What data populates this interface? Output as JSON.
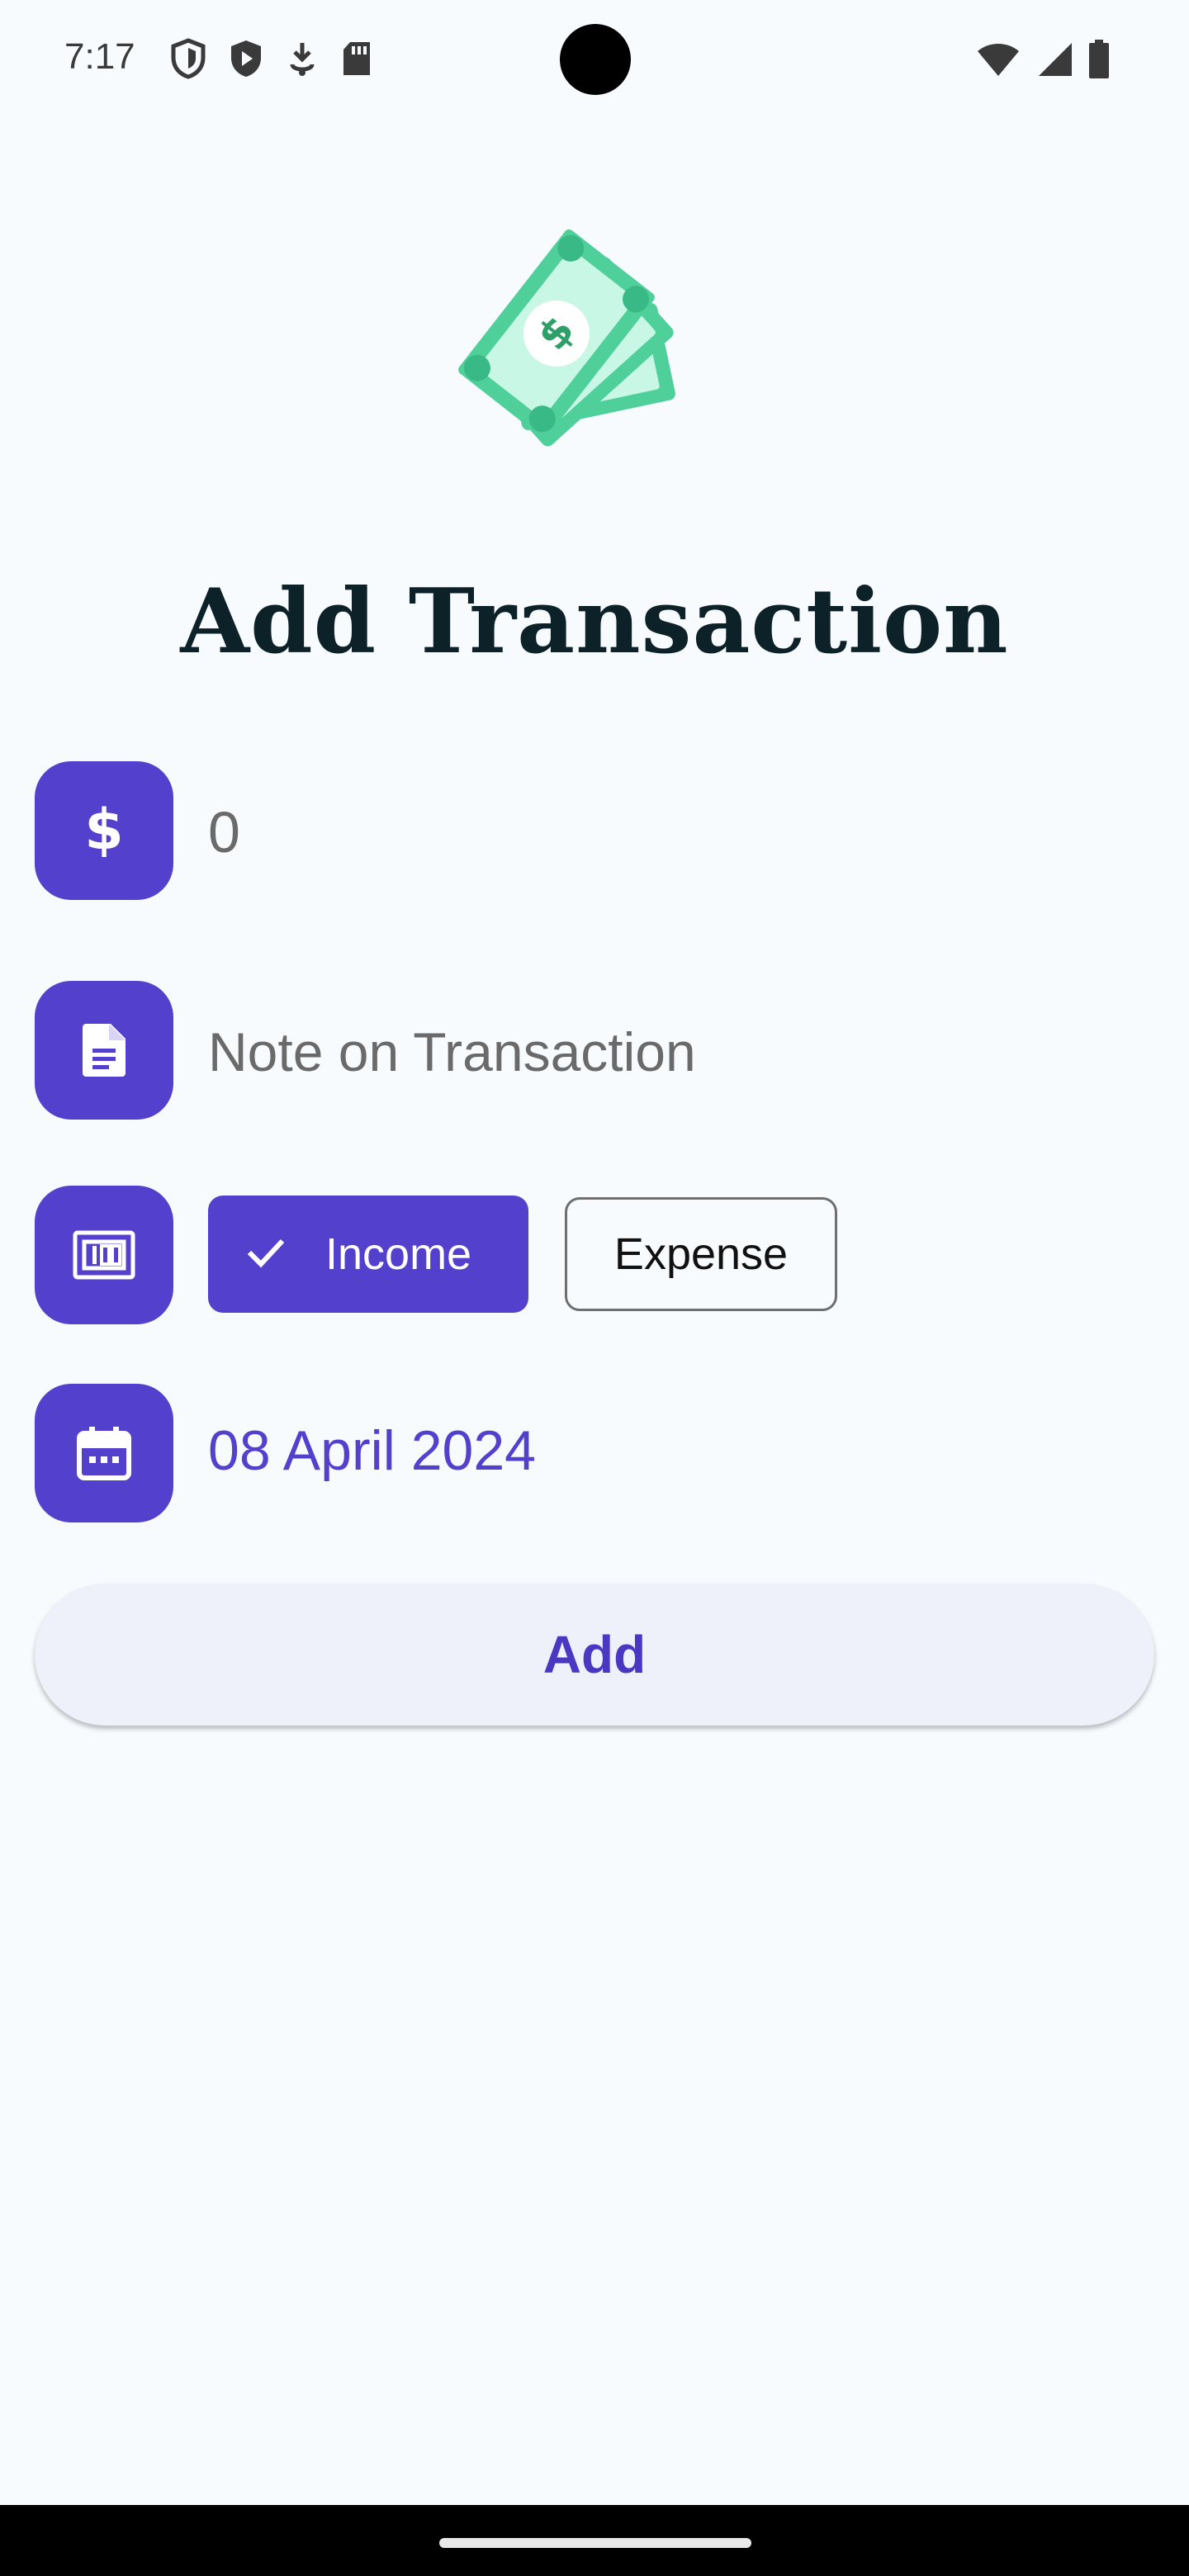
{
  "status_bar": {
    "time": "7:17",
    "left_icons": [
      "shield-outline-icon",
      "shield-play-icon",
      "download-icon",
      "sd-card-icon"
    ],
    "right_icons": [
      "wifi-icon",
      "signal-icon",
      "battery-icon"
    ]
  },
  "header": {
    "title": "Add Transaction",
    "illustration": "money-bills-icon"
  },
  "form": {
    "amount": {
      "icon": "dollar-icon",
      "value": "0"
    },
    "note": {
      "icon": "document-icon",
      "placeholder": "Note on Transaction"
    },
    "type": {
      "icon": "money-counter-icon",
      "options": [
        {
          "label": "Income",
          "selected": true
        },
        {
          "label": "Expense",
          "selected": false
        }
      ]
    },
    "date": {
      "icon": "calendar-icon",
      "value": "08 April 2024"
    },
    "submit_label": "Add"
  },
  "colors": {
    "accent": "#5340cc",
    "background": "#f8fbfe",
    "title": "#0d2128",
    "illustration_green": "#4fcf9a"
  }
}
